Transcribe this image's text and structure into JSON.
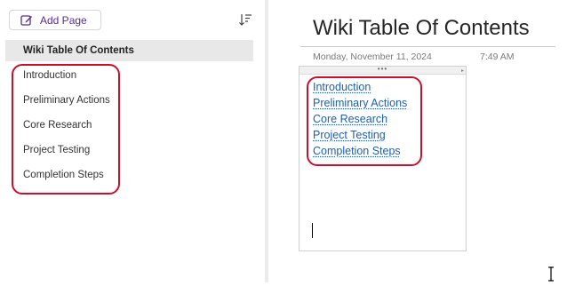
{
  "sidebar": {
    "add_page_label": "Add Page",
    "add_page_icon": "edit-page-icon",
    "sort_icon": "sort-descending-icon",
    "pages": [
      {
        "label": "Wiki Table Of Contents",
        "selected": true
      },
      {
        "label": "Introduction",
        "selected": false
      },
      {
        "label": "Preliminary Actions",
        "selected": false
      },
      {
        "label": "Core Research",
        "selected": false
      },
      {
        "label": "Project Testing",
        "selected": false
      },
      {
        "label": "Completion Steps",
        "selected": false
      }
    ]
  },
  "note": {
    "title": "Wiki Table Of Contents",
    "date": "Monday, November 11, 2024",
    "time": "7:49 AM",
    "links": [
      "Introduction",
      "Preliminary Actions",
      "Core Research",
      "Project Testing",
      "Completion Steps"
    ],
    "handle_glyph": "•••",
    "scroll_glyph": "▸"
  },
  "colors": {
    "accent": "#5b2d91",
    "highlight_outline": "#c8102e",
    "link": "#1d5fb8",
    "selected_bg": "#e8e8e8"
  }
}
